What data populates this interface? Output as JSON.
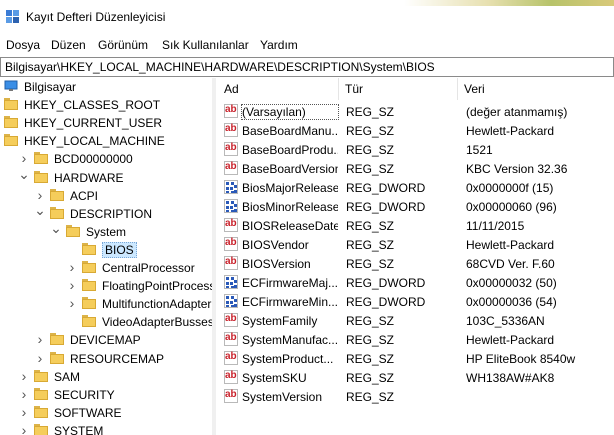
{
  "window": {
    "title": "Kayıt Defteri Düzenleyicisi"
  },
  "menu": [
    "Dosya",
    "Düzen",
    "Görünüm",
    "Sık Kullanılanlar",
    "Yardım"
  ],
  "address": "Bilgisayar\\HKEY_LOCAL_MACHINE\\HARDWARE\\DESCRIPTION\\System\\BIOS",
  "tree": [
    {
      "label": "Bilgisayar",
      "depth": 0,
      "arrow": "",
      "icon": "computer-icon"
    },
    {
      "label": "HKEY_CLASSES_ROOT",
      "depth": 0,
      "arrow": "",
      "icon": "folder-icon"
    },
    {
      "label": "HKEY_CURRENT_USER",
      "depth": 0,
      "arrow": "",
      "icon": "folder-icon"
    },
    {
      "label": "HKEY_LOCAL_MACHINE",
      "depth": 0,
      "arrow": "",
      "icon": "folder-icon"
    },
    {
      "label": "BCD00000000",
      "depth": 1,
      "arrow": ">",
      "icon": "folder-icon"
    },
    {
      "label": "HARDWARE",
      "depth": 1,
      "arrow": "v",
      "icon": "folder-icon"
    },
    {
      "label": "ACPI",
      "depth": 2,
      "arrow": ">",
      "icon": "folder-icon"
    },
    {
      "label": "DESCRIPTION",
      "depth": 2,
      "arrow": "v",
      "icon": "folder-icon"
    },
    {
      "label": "System",
      "depth": 3,
      "arrow": "v",
      "icon": "folder-icon"
    },
    {
      "label": "BIOS",
      "depth": 4,
      "arrow": "",
      "icon": "folder-icon",
      "selected": true
    },
    {
      "label": "CentralProcessor",
      "depth": 4,
      "arrow": ">",
      "icon": "folder-icon"
    },
    {
      "label": "FloatingPointProcessor",
      "depth": 4,
      "arrow": ">",
      "icon": "folder-icon"
    },
    {
      "label": "MultifunctionAdapter",
      "depth": 4,
      "arrow": ">",
      "icon": "folder-icon"
    },
    {
      "label": "VideoAdapterBusses",
      "depth": 4,
      "arrow": "",
      "icon": "folder-icon"
    },
    {
      "label": "DEVICEMAP",
      "depth": 2,
      "arrow": ">",
      "icon": "folder-icon"
    },
    {
      "label": "RESOURCEMAP",
      "depth": 2,
      "arrow": ">",
      "icon": "folder-icon"
    },
    {
      "label": "SAM",
      "depth": 1,
      "arrow": ">",
      "icon": "folder-icon"
    },
    {
      "label": "SECURITY",
      "depth": 1,
      "arrow": ">",
      "icon": "folder-icon"
    },
    {
      "label": "SOFTWARE",
      "depth": 1,
      "arrow": ">",
      "icon": "folder-icon"
    },
    {
      "label": "SYSTEM",
      "depth": 1,
      "arrow": ">",
      "icon": "folder-icon"
    }
  ],
  "columns": [
    "Ad",
    "Tür",
    "Veri"
  ],
  "values": [
    {
      "name": "(Varsayılan)",
      "type": "REG_SZ",
      "data": "(değer atanmamış)",
      "kind": "sz",
      "selected": true
    },
    {
      "name": "BaseBoardManu...",
      "type": "REG_SZ",
      "data": "Hewlett-Packard",
      "kind": "sz"
    },
    {
      "name": "BaseBoardProdu...",
      "type": "REG_SZ",
      "data": "1521",
      "kind": "sz"
    },
    {
      "name": "BaseBoardVersion",
      "type": "REG_SZ",
      "data": "KBC Version 32.36",
      "kind": "sz"
    },
    {
      "name": "BiosMajorRelease",
      "type": "REG_DWORD",
      "data": "0x0000000f (15)",
      "kind": "dword"
    },
    {
      "name": "BiosMinorRelease",
      "type": "REG_DWORD",
      "data": "0x00000060 (96)",
      "kind": "dword"
    },
    {
      "name": "BIOSReleaseDate",
      "type": "REG_SZ",
      "data": "11/11/2015",
      "kind": "sz"
    },
    {
      "name": "BIOSVendor",
      "type": "REG_SZ",
      "data": "Hewlett-Packard",
      "kind": "sz"
    },
    {
      "name": "BIOSVersion",
      "type": "REG_SZ",
      "data": "68CVD Ver. F.60",
      "kind": "sz"
    },
    {
      "name": "ECFirmwareMaj...",
      "type": "REG_DWORD",
      "data": "0x00000032 (50)",
      "kind": "dword"
    },
    {
      "name": "ECFirmwareMin...",
      "type": "REG_DWORD",
      "data": "0x00000036 (54)",
      "kind": "dword"
    },
    {
      "name": "SystemFamily",
      "type": "REG_SZ",
      "data": "103C_5336AN",
      "kind": "sz"
    },
    {
      "name": "SystemManufac...",
      "type": "REG_SZ",
      "data": "Hewlett-Packard",
      "kind": "sz"
    },
    {
      "name": "SystemProduct...",
      "type": "REG_SZ",
      "data": "HP EliteBook 8540w",
      "kind": "sz"
    },
    {
      "name": "SystemSKU",
      "type": "REG_SZ",
      "data": "WH138AW#AK8",
      "kind": "sz"
    },
    {
      "name": "SystemVersion",
      "type": "REG_SZ",
      "data": "",
      "kind": "sz"
    }
  ],
  "icon_text": {
    "sz": "ab"
  },
  "colors": {
    "folder": "#f5cd5b",
    "selection": "#cce8ff",
    "sz_icon": "#c8202a",
    "dword_icon": "#2a59b8"
  }
}
